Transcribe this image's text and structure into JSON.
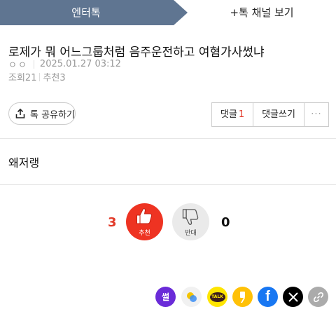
{
  "tabs": {
    "active_label": "엔터톡",
    "other_label": "+톡 채널 보기",
    "active_color": "#5f7591"
  },
  "post": {
    "title": "로제가 뭐 어느그룹처럼 음주운전하고 여혐가사썼냐",
    "author": "ㅇㅇ",
    "datetime": "2025.01.27 03:12",
    "views": "조회21",
    "recommends": "추천3"
  },
  "actions": {
    "share_label": "톡 공유하기",
    "comments_label": "댓글",
    "comments_count": "1",
    "write_comment_label": "댓글쓰기",
    "more_label": "···"
  },
  "content": {
    "body": "왜저랭"
  },
  "votes": {
    "up_count": "3",
    "up_label": "추천",
    "down_count": "0",
    "down_label": "반대",
    "up_color": "#ee3322"
  },
  "share_icons": {
    "sseol_label": "썰",
    "kakao_label": "TALK",
    "facebook_label": "f",
    "x_label": "𝕏",
    "icons": [
      "sseol-icon",
      "band-icon",
      "kakaotalk-icon",
      "kakaostory-icon",
      "facebook-icon",
      "x-icon",
      "link-icon"
    ]
  }
}
